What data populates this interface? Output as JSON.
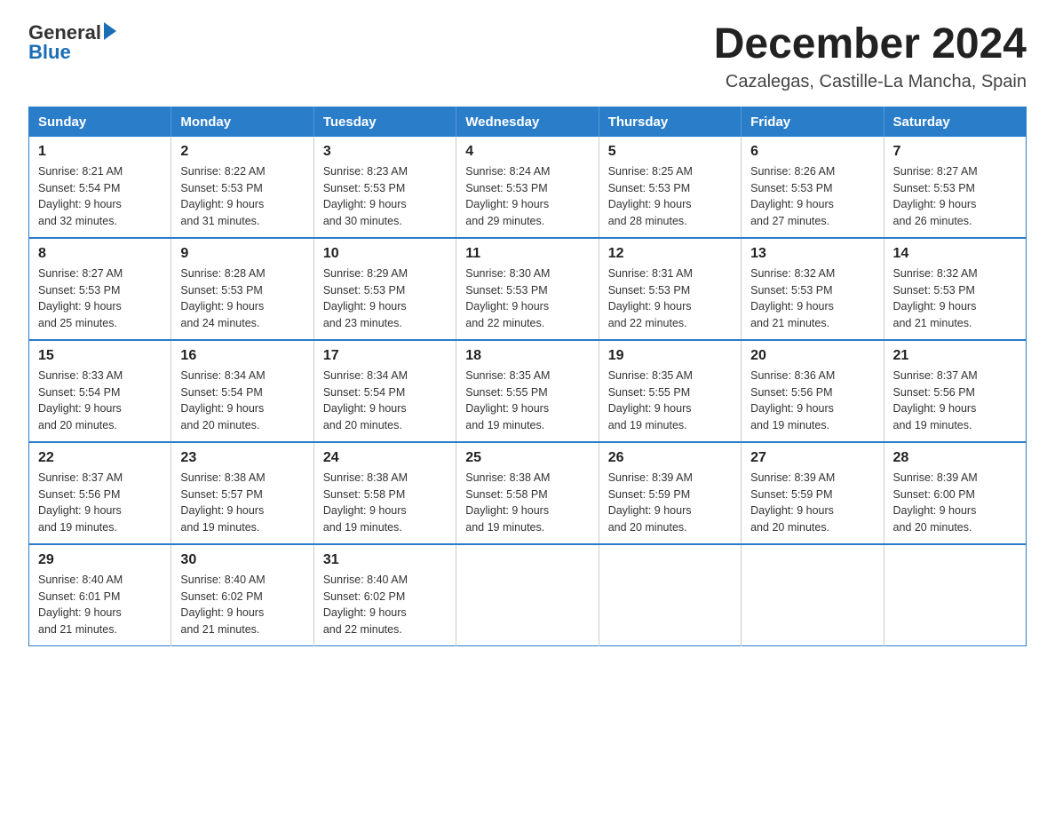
{
  "logo": {
    "general": "General",
    "blue": "Blue"
  },
  "header": {
    "title": "December 2024",
    "subtitle": "Cazalegas, Castille-La Mancha, Spain"
  },
  "weekdays": [
    "Sunday",
    "Monday",
    "Tuesday",
    "Wednesday",
    "Thursday",
    "Friday",
    "Saturday"
  ],
  "weeks": [
    [
      {
        "day": "1",
        "sunrise": "8:21 AM",
        "sunset": "5:54 PM",
        "daylight": "9 hours and 32 minutes."
      },
      {
        "day": "2",
        "sunrise": "8:22 AM",
        "sunset": "5:53 PM",
        "daylight": "9 hours and 31 minutes."
      },
      {
        "day": "3",
        "sunrise": "8:23 AM",
        "sunset": "5:53 PM",
        "daylight": "9 hours and 30 minutes."
      },
      {
        "day": "4",
        "sunrise": "8:24 AM",
        "sunset": "5:53 PM",
        "daylight": "9 hours and 29 minutes."
      },
      {
        "day": "5",
        "sunrise": "8:25 AM",
        "sunset": "5:53 PM",
        "daylight": "9 hours and 28 minutes."
      },
      {
        "day": "6",
        "sunrise": "8:26 AM",
        "sunset": "5:53 PM",
        "daylight": "9 hours and 27 minutes."
      },
      {
        "day": "7",
        "sunrise": "8:27 AM",
        "sunset": "5:53 PM",
        "daylight": "9 hours and 26 minutes."
      }
    ],
    [
      {
        "day": "8",
        "sunrise": "8:27 AM",
        "sunset": "5:53 PM",
        "daylight": "9 hours and 25 minutes."
      },
      {
        "day": "9",
        "sunrise": "8:28 AM",
        "sunset": "5:53 PM",
        "daylight": "9 hours and 24 minutes."
      },
      {
        "day": "10",
        "sunrise": "8:29 AM",
        "sunset": "5:53 PM",
        "daylight": "9 hours and 23 minutes."
      },
      {
        "day": "11",
        "sunrise": "8:30 AM",
        "sunset": "5:53 PM",
        "daylight": "9 hours and 22 minutes."
      },
      {
        "day": "12",
        "sunrise": "8:31 AM",
        "sunset": "5:53 PM",
        "daylight": "9 hours and 22 minutes."
      },
      {
        "day": "13",
        "sunrise": "8:32 AM",
        "sunset": "5:53 PM",
        "daylight": "9 hours and 21 minutes."
      },
      {
        "day": "14",
        "sunrise": "8:32 AM",
        "sunset": "5:53 PM",
        "daylight": "9 hours and 21 minutes."
      }
    ],
    [
      {
        "day": "15",
        "sunrise": "8:33 AM",
        "sunset": "5:54 PM",
        "daylight": "9 hours and 20 minutes."
      },
      {
        "day": "16",
        "sunrise": "8:34 AM",
        "sunset": "5:54 PM",
        "daylight": "9 hours and 20 minutes."
      },
      {
        "day": "17",
        "sunrise": "8:34 AM",
        "sunset": "5:54 PM",
        "daylight": "9 hours and 20 minutes."
      },
      {
        "day": "18",
        "sunrise": "8:35 AM",
        "sunset": "5:55 PM",
        "daylight": "9 hours and 19 minutes."
      },
      {
        "day": "19",
        "sunrise": "8:35 AM",
        "sunset": "5:55 PM",
        "daylight": "9 hours and 19 minutes."
      },
      {
        "day": "20",
        "sunrise": "8:36 AM",
        "sunset": "5:56 PM",
        "daylight": "9 hours and 19 minutes."
      },
      {
        "day": "21",
        "sunrise": "8:37 AM",
        "sunset": "5:56 PM",
        "daylight": "9 hours and 19 minutes."
      }
    ],
    [
      {
        "day": "22",
        "sunrise": "8:37 AM",
        "sunset": "5:56 PM",
        "daylight": "9 hours and 19 minutes."
      },
      {
        "day": "23",
        "sunrise": "8:38 AM",
        "sunset": "5:57 PM",
        "daylight": "9 hours and 19 minutes."
      },
      {
        "day": "24",
        "sunrise": "8:38 AM",
        "sunset": "5:58 PM",
        "daylight": "9 hours and 19 minutes."
      },
      {
        "day": "25",
        "sunrise": "8:38 AM",
        "sunset": "5:58 PM",
        "daylight": "9 hours and 19 minutes."
      },
      {
        "day": "26",
        "sunrise": "8:39 AM",
        "sunset": "5:59 PM",
        "daylight": "9 hours and 20 minutes."
      },
      {
        "day": "27",
        "sunrise": "8:39 AM",
        "sunset": "5:59 PM",
        "daylight": "9 hours and 20 minutes."
      },
      {
        "day": "28",
        "sunrise": "8:39 AM",
        "sunset": "6:00 PM",
        "daylight": "9 hours and 20 minutes."
      }
    ],
    [
      {
        "day": "29",
        "sunrise": "8:40 AM",
        "sunset": "6:01 PM",
        "daylight": "9 hours and 21 minutes."
      },
      {
        "day": "30",
        "sunrise": "8:40 AM",
        "sunset": "6:02 PM",
        "daylight": "9 hours and 21 minutes."
      },
      {
        "day": "31",
        "sunrise": "8:40 AM",
        "sunset": "6:02 PM",
        "daylight": "9 hours and 22 minutes."
      },
      null,
      null,
      null,
      null
    ]
  ],
  "labels": {
    "sunrise": "Sunrise:",
    "sunset": "Sunset:",
    "daylight": "Daylight:"
  }
}
